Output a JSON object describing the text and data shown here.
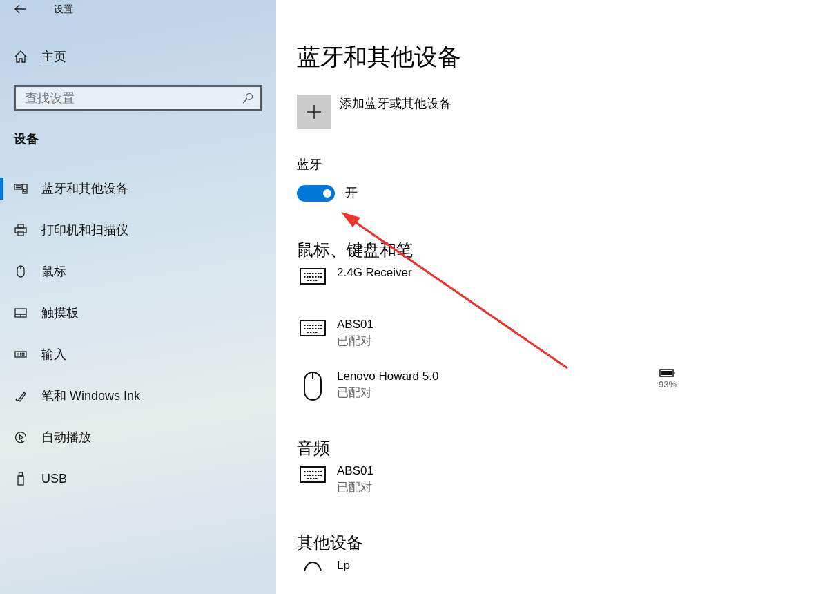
{
  "window": {
    "title": "设置"
  },
  "sidebar": {
    "home": "主页",
    "search": {
      "placeholder": "查找设置"
    },
    "section": "设备",
    "items": [
      {
        "label": "蓝牙和其他设备",
        "kind": "bluetooth",
        "selected": true
      },
      {
        "label": "打印机和扫描仪",
        "kind": "printer",
        "selected": false
      },
      {
        "label": "鼠标",
        "kind": "mouse",
        "selected": false
      },
      {
        "label": "触摸板",
        "kind": "touchpad",
        "selected": false
      },
      {
        "label": "输入",
        "kind": "keyboard",
        "selected": false
      },
      {
        "label": "笔和 Windows Ink",
        "kind": "pen",
        "selected": false
      },
      {
        "label": "自动播放",
        "kind": "autoplay",
        "selected": false
      },
      {
        "label": "USB",
        "kind": "usb",
        "selected": false
      }
    ]
  },
  "page": {
    "title": "蓝牙和其他设备",
    "add_button": "添加蓝牙或其他设备",
    "bluetooth": {
      "label": "蓝牙",
      "on": true,
      "state_text": "开"
    },
    "sections": [
      {
        "title": "鼠标、键盘和笔",
        "devices": [
          {
            "name": "2.4G Receiver",
            "kind": "keyboard"
          },
          {
            "name": "ABS01",
            "status": "已配对",
            "kind": "keyboard"
          },
          {
            "name": "Lenovo Howard 5.0",
            "status": "已配对",
            "kind": "mouse",
            "battery": "93%"
          }
        ]
      },
      {
        "title": "音频",
        "devices": [
          {
            "name": "ABS01",
            "status": "已配对",
            "kind": "keyboard"
          }
        ]
      },
      {
        "title": "其他设备",
        "devices": [
          {
            "name": "Lp",
            "kind": "other"
          }
        ]
      }
    ]
  }
}
